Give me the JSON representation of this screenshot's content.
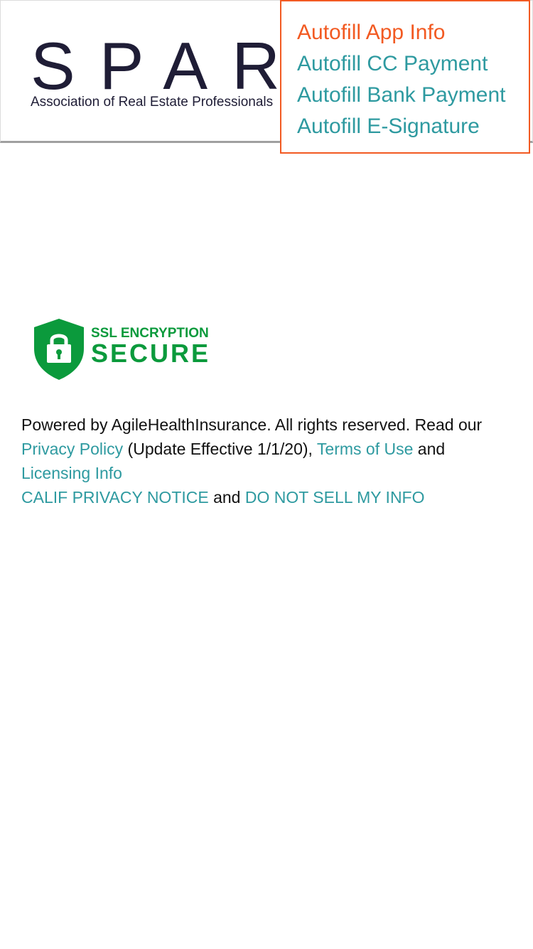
{
  "header": {
    "logo": {
      "wordmark": "SPARK",
      "tagline": "Association of Real Estate Professionals"
    }
  },
  "autofill_menu": {
    "items": [
      {
        "label": "Autofill App Info"
      },
      {
        "label": "Autofill CC Payment"
      },
      {
        "label": "Autofill Bank Payment"
      },
      {
        "label": "Autofill E-Signature"
      }
    ]
  },
  "ssl_badge": {
    "line1": "SSL ENCRYPTION",
    "line2": "SECURE",
    "icon": "lock-shield-icon"
  },
  "footer": {
    "powered_text": "Powered by AgileHealthInsurance. All rights reserved. Read our",
    "privacy_policy_link": "Privacy Policy",
    "update_text": "(Update Effective 1/1/20),",
    "terms_link": "Terms of Use",
    "and_1": "and",
    "licensing_link": "Licensing Info",
    "calif_privacy_link": "CALIF PRIVACY NOTICE",
    "and_2": "and",
    "do_not_sell_link": "DO NOT SELL MY INFO"
  },
  "colors": {
    "link": "#2e9aa0",
    "active": "#f25a22",
    "ssl_green": "#0b9a3c",
    "logo_text": "#1f1d36"
  }
}
